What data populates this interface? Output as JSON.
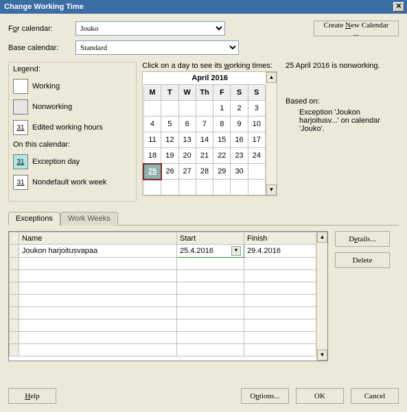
{
  "title": "Change Working Time",
  "labels": {
    "for_calendar": "For calendar:",
    "base_calendar": "Base calendar:",
    "create_new": "Create New Calendar ...",
    "legend": "Legend:",
    "working": "Working",
    "nonworking": "Nonworking",
    "edited": "Edited working hours",
    "on_this": "On this calendar:",
    "exception_day": "Exception day",
    "nondefault": "Nondefault work week",
    "click_day": "Click on a day to see its working times:",
    "month": "April 2016",
    "status": "25 April 2016 is nonworking.",
    "based_on": "Based on:",
    "based_on_detail": "Exception 'Joukon harjoitusv...' on calendar 'Jouko'.",
    "tab_exceptions": "Exceptions",
    "tab_workweeks": "Work Weeks",
    "col_name": "Name",
    "col_start": "Start",
    "col_finish": "Finish",
    "details": "Details...",
    "delete": "Delete",
    "help": "Help",
    "options": "Options...",
    "ok": "OK",
    "cancel": "Cancel",
    "glyph31": "31"
  },
  "for_calendar_value": "Jouko",
  "base_calendar_value": "Standard",
  "day_headers": [
    "M",
    "T",
    "W",
    "Th",
    "F",
    "S",
    "S"
  ],
  "calendar_rows": [
    [
      "",
      "",
      "",
      "",
      "1",
      "2",
      "3"
    ],
    [
      "4",
      "5",
      "6",
      "7",
      "8",
      "9",
      "10"
    ],
    [
      "11",
      "12",
      "13",
      "14",
      "15",
      "16",
      "17"
    ],
    [
      "18",
      "19",
      "20",
      "21",
      "22",
      "23",
      "24"
    ],
    [
      "25",
      "26",
      "27",
      "28",
      "29",
      "30",
      ""
    ],
    [
      "",
      "",
      "",
      "",
      "",
      "",
      ""
    ]
  ],
  "exception_days": [
    "25",
    "26",
    "27",
    "28",
    "29"
  ],
  "exception_row": {
    "name": "Joukon harjoitusvapaa",
    "start": "25.4.2016",
    "finish": "29.4.2016"
  }
}
